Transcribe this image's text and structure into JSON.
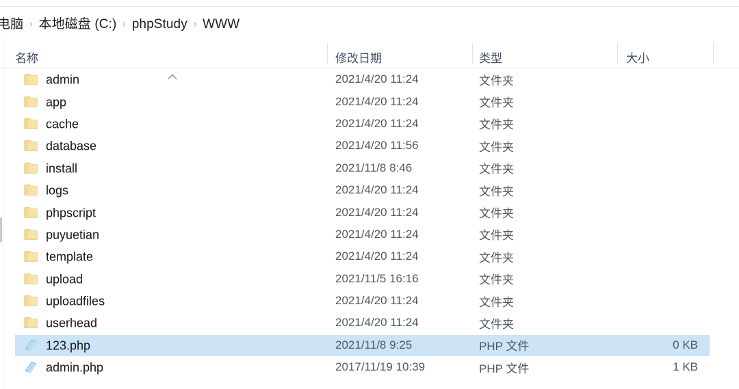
{
  "breadcrumb": {
    "separator": "›",
    "items": [
      {
        "label": "电脑"
      },
      {
        "label": "本地磁盘 (C:)"
      },
      {
        "label": "phpStudy"
      },
      {
        "label": "WWW"
      }
    ]
  },
  "columns": {
    "name": "名称",
    "date_modified": "修改日期",
    "type": "类型",
    "size": "大小",
    "sort_indicator": "ascending"
  },
  "colors": {
    "selection": "#cde4f7",
    "folder_icon": "#f5d98a",
    "php_icon": "#9fd8f2",
    "header_text": "#3c536b",
    "name_text": "#151515",
    "meta_text": "#53585e"
  },
  "files": [
    {
      "icon": "folder-icon",
      "name": "admin",
      "date": "2021/4/20 11:24",
      "type": "文件夹",
      "size": "",
      "selected": false
    },
    {
      "icon": "folder-icon",
      "name": "app",
      "date": "2021/4/20 11:24",
      "type": "文件夹",
      "size": "",
      "selected": false
    },
    {
      "icon": "folder-icon",
      "name": "cache",
      "date": "2021/4/20 11:24",
      "type": "文件夹",
      "size": "",
      "selected": false
    },
    {
      "icon": "folder-icon",
      "name": "database",
      "date": "2021/4/20 11:56",
      "type": "文件夹",
      "size": "",
      "selected": false
    },
    {
      "icon": "folder-icon",
      "name": "install",
      "date": "2021/11/8 8:46",
      "type": "文件夹",
      "size": "",
      "selected": false
    },
    {
      "icon": "folder-icon",
      "name": "logs",
      "date": "2021/4/20 11:24",
      "type": "文件夹",
      "size": "",
      "selected": false
    },
    {
      "icon": "folder-icon",
      "name": "phpscript",
      "date": "2021/4/20 11:24",
      "type": "文件夹",
      "size": "",
      "selected": false
    },
    {
      "icon": "folder-icon",
      "name": "puyuetian",
      "date": "2021/4/20 11:24",
      "type": "文件夹",
      "size": "",
      "selected": false
    },
    {
      "icon": "folder-icon",
      "name": "template",
      "date": "2021/4/20 11:24",
      "type": "文件夹",
      "size": "",
      "selected": false
    },
    {
      "icon": "folder-icon",
      "name": "upload",
      "date": "2021/11/5 16:16",
      "type": "文件夹",
      "size": "",
      "selected": false
    },
    {
      "icon": "folder-icon",
      "name": "uploadfiles",
      "date": "2021/4/20 11:24",
      "type": "文件夹",
      "size": "",
      "selected": false
    },
    {
      "icon": "folder-icon",
      "name": "userhead",
      "date": "2021/4/20 11:24",
      "type": "文件夹",
      "size": "",
      "selected": false
    },
    {
      "icon": "php-file-icon",
      "name": "123.php",
      "date": "2021/11/8 9:25",
      "type": "PHP 文件",
      "size": "0 KB",
      "selected": true
    },
    {
      "icon": "php-file-icon",
      "name": "admin.php",
      "date": "2017/11/19 10:39",
      "type": "PHP 文件",
      "size": "1 KB",
      "selected": false
    }
  ]
}
